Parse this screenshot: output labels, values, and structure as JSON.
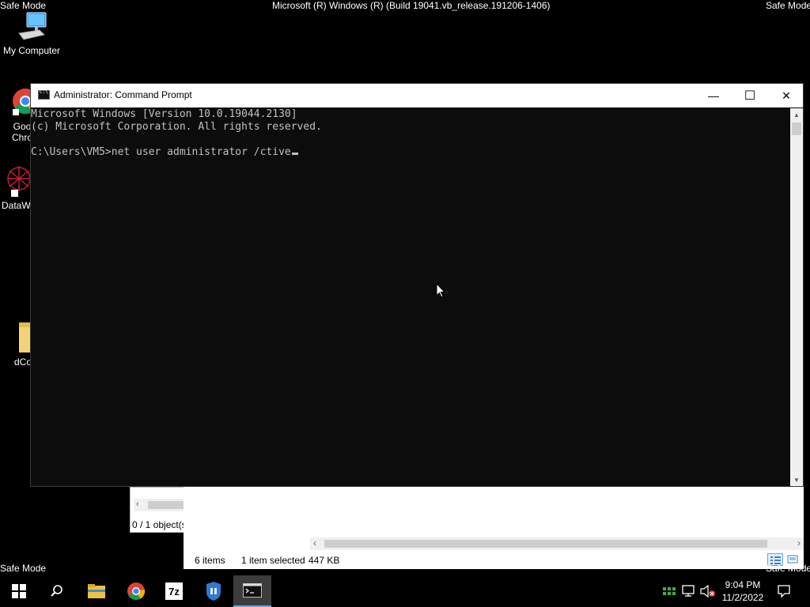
{
  "desktop": {
    "safe_mode_top_left": "Safe Mode",
    "safe_mode_top_right": "Safe Mode",
    "safe_mode_bottom_left": "Safe Mode",
    "safe_mode_bottom_right": "Safe Mode",
    "build_string": "Microsoft (R) Windows (R) (Build 19041.vb_release.191206-1406)",
    "icons": [
      {
        "label": "My Computer",
        "icon": "computer-icon"
      },
      {
        "label_line1": "Goo",
        "label_line2": "Chro",
        "icon": "chrome-icon"
      },
      {
        "label": "DataW",
        "icon": "datawarehouse-icon"
      },
      {
        "label": "dCo",
        "icon": "folder-icon"
      }
    ]
  },
  "explorer": {
    "status_items": "6 items",
    "status_selected": "1 item selected",
    "status_size": "447 KB",
    "left_status": "0 / 1 object(s"
  },
  "cmd": {
    "title": "Administrator: Command Prompt",
    "lines": [
      "Microsoft Windows [Version 10.0.19044.2130]",
      "(c) Microsoft Corporation. All rights reserved.",
      "",
      "C:\\Users\\VM5>net user administrator /ctive"
    ],
    "minimize_glyph": "—",
    "maximize_glyph": "☐",
    "close_glyph": "✕"
  },
  "taskbar": {
    "apps": [
      "start-icon",
      "search-icon",
      "file-explorer-icon",
      "chrome-icon",
      "7zip-icon",
      "security-icon",
      "command-prompt-icon"
    ],
    "time": "9:04 PM",
    "date": "11/2/2022"
  },
  "colors": {
    "desktop_bg": "#000000",
    "console_bg": "#0c0c0c",
    "console_text": "#c0c0c0",
    "titlebar_bg": "#ffffff"
  }
}
